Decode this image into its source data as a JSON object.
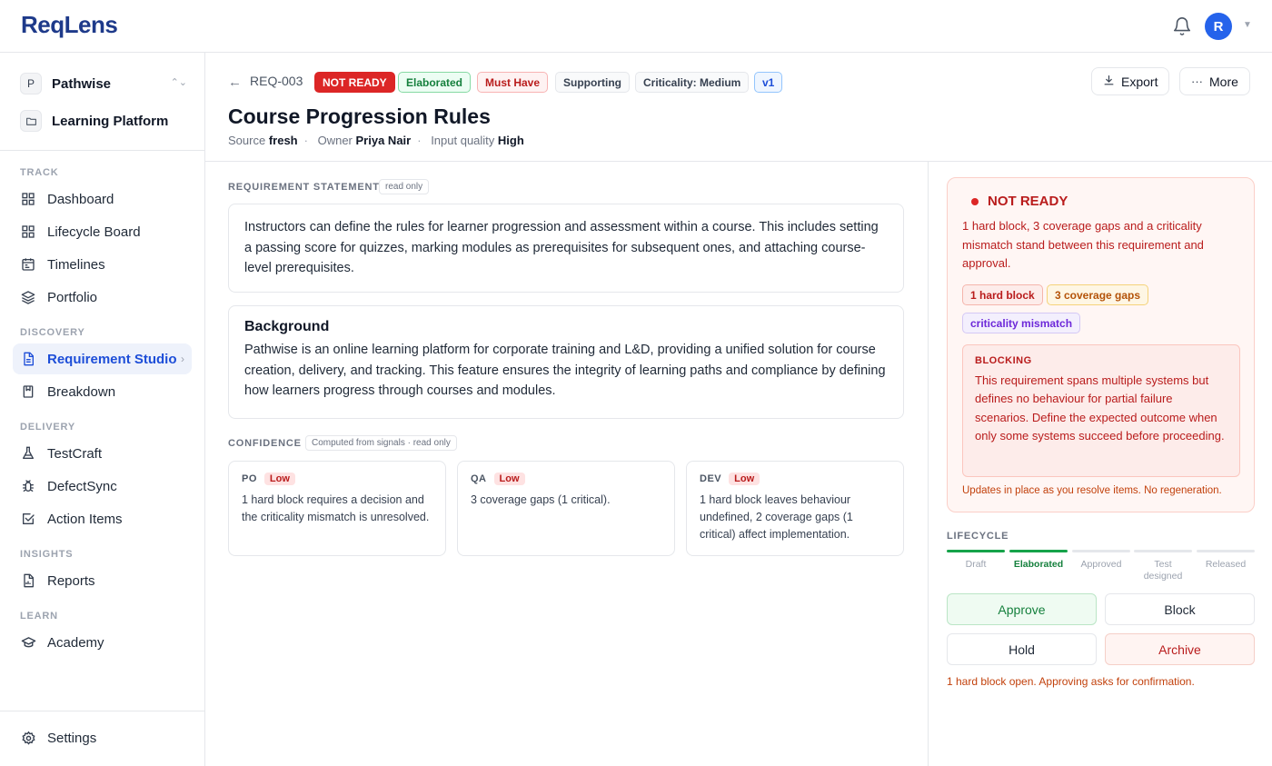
{
  "app": {
    "logo": "ReqLens",
    "avatar_initial": "R"
  },
  "sidebar": {
    "workspace": {
      "initial": "P",
      "name": "Pathwise"
    },
    "project": {
      "name": "Learning Platform"
    },
    "sections": [
      {
        "label": "TRACK",
        "items": [
          {
            "label": "Dashboard",
            "icon": "grid-icon"
          },
          {
            "label": "Lifecycle Board",
            "icon": "grid-icon"
          },
          {
            "label": "Timelines",
            "icon": "calendar-icon"
          },
          {
            "label": "Portfolio",
            "icon": "layers-icon"
          }
        ]
      },
      {
        "label": "DISCOVERY",
        "items": [
          {
            "label": "Requirement Studio",
            "icon": "document-icon",
            "active": true
          },
          {
            "label": "Breakdown",
            "icon": "bookmark-icon"
          }
        ]
      },
      {
        "label": "DELIVERY",
        "items": [
          {
            "label": "TestCraft",
            "icon": "flask-icon"
          },
          {
            "label": "DefectSync",
            "icon": "bug-icon"
          },
          {
            "label": "Action Items",
            "icon": "checkbox-icon"
          }
        ]
      },
      {
        "label": "INSIGHTS",
        "items": [
          {
            "label": "Reports",
            "icon": "report-icon"
          }
        ]
      },
      {
        "label": "LEARN",
        "items": [
          {
            "label": "Academy",
            "icon": "graduation-cap-icon"
          }
        ]
      }
    ],
    "settings": "Settings"
  },
  "header": {
    "req_id": "REQ-003",
    "tags": {
      "status": "NOT READY",
      "stage": "Elaborated",
      "priority": "Must Have",
      "type": "Supporting",
      "criticality": "Criticality: Medium",
      "version": "v1"
    },
    "title": "Course Progression Rules",
    "meta": {
      "source_label": "Source",
      "source_value": "fresh",
      "owner_label": "Owner",
      "owner_value": "Priya Nair",
      "quality_label": "Input quality",
      "quality_value": "High"
    },
    "export_label": "Export",
    "more_label": "More"
  },
  "statement": {
    "label": "REQUIREMENT STATEMENT",
    "chip": "read only",
    "text": "Instructors can define the rules for learner progression and assessment within a course. This includes setting a passing score for quizzes, marking modules as prerequisites for subsequent ones, and attaching course-level prerequisites."
  },
  "background": {
    "title": "Background",
    "text": "Pathwise is an online learning platform for corporate training and L&D, providing a unified solution for course creation, delivery, and tracking. This feature ensures the integrity of learning paths and compliance by defining how learners progress through courses and modules."
  },
  "confidence": {
    "label": "CONFIDENCE",
    "chip": "Computed from signals · read only",
    "cards": [
      {
        "role": "PO",
        "level": "Low",
        "text": "1 hard block requires a decision and the criticality mismatch is unresolved."
      },
      {
        "role": "QA",
        "level": "Low",
        "text": "3 coverage gaps (1 critical)."
      },
      {
        "role": "DEV",
        "level": "Low",
        "text": "1 hard block leaves behaviour undefined, 2 coverage gaps (1 critical) affect implementation."
      }
    ]
  },
  "readiness": {
    "title": "NOT READY",
    "description": "1 hard block, 3 coverage gaps and a criticality mismatch stand between this requirement and approval.",
    "pills": {
      "hard_block": "1 hard block",
      "coverage": "3 coverage gaps",
      "mismatch": "criticality mismatch"
    },
    "blocking_label": "BLOCKING",
    "blocking_text": "This requirement spans multiple systems but defines no behaviour for partial failure scenarios. Define the expected outcome when only some systems succeed before proceeding.",
    "footer": "Updates in place as you resolve items. No regeneration."
  },
  "lifecycle": {
    "label": "LIFECYCLE",
    "steps": [
      "Draft",
      "Elaborated",
      "Approved",
      "Test designed",
      "Released"
    ],
    "current_index": 1
  },
  "actions": {
    "approve": "Approve",
    "block": "Block",
    "hold": "Hold",
    "archive": "Archive",
    "note": "1 hard block open. Approving asks for confirmation."
  },
  "colors": {
    "brand": "#1e3a8a",
    "accent": "#2563eb",
    "danger": "#dc2626",
    "success": "#16a34a"
  }
}
